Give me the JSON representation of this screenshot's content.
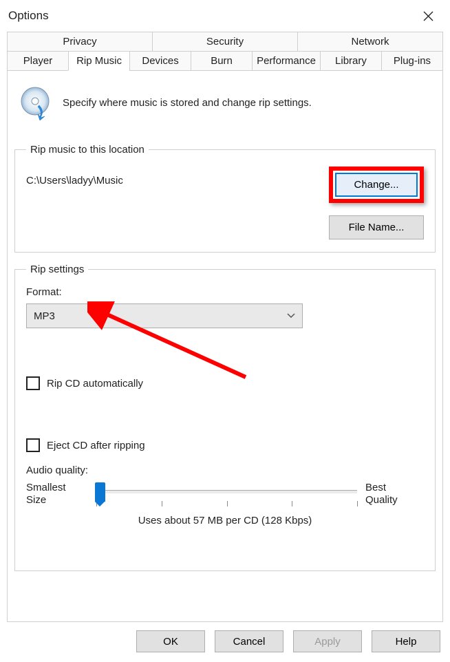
{
  "window": {
    "title": "Options"
  },
  "tabs": {
    "row1": [
      "Privacy",
      "Security",
      "Network"
    ],
    "row2": [
      "Player",
      "Rip Music",
      "Devices",
      "Burn",
      "Performance",
      "Library",
      "Plug-ins"
    ],
    "active": "Rip Music"
  },
  "intro": {
    "text": "Specify where music is stored and change rip settings.",
    "icon": "cd-rip-icon"
  },
  "location_group": {
    "legend": "Rip music to this location",
    "path": "C:\\Users\\ladyy\\Music",
    "change_label": "Change...",
    "filename_label": "File Name..."
  },
  "settings_group": {
    "legend": "Rip settings",
    "format_label": "Format:",
    "format_value": "MP3",
    "rip_auto_label": "Rip CD automatically",
    "rip_auto_checked": false,
    "eject_label": "Eject CD after ripping",
    "eject_checked": false,
    "quality_label": "Audio quality:",
    "quality_min_line1": "Smallest",
    "quality_min_line2": "Size",
    "quality_max_line1": "Best",
    "quality_max_line2": "Quality",
    "slider_note": "Uses about 57 MB per CD (128 Kbps)"
  },
  "footer": {
    "ok": "OK",
    "cancel": "Cancel",
    "apply": "Apply",
    "help": "Help"
  },
  "annotations": {
    "change_button_highlighted": true,
    "arrow_points_to": "format-select"
  }
}
